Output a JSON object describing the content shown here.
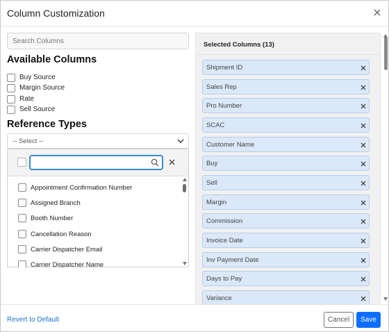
{
  "modal": {
    "title": "Column Customization",
    "close_icon": "close-icon"
  },
  "left": {
    "search_placeholder": "Search Columns",
    "available_heading": "Available Columns",
    "available_columns": [
      "Buy Source",
      "Margin Source",
      "Rate",
      "Sell Source"
    ],
    "reference_heading": "Reference Types",
    "reference_select": {
      "selected": "-- Select --",
      "search_value": "",
      "items": [
        "Appointment Confirmation Number",
        "Assigned Branch",
        "Booth Number",
        "Cancellation Reason",
        "Carrier Dispatcher Email",
        "Carrier Dispatcher Name"
      ]
    }
  },
  "right": {
    "title": "Selected Columns (13)",
    "selected_columns": [
      "Shipment ID",
      "Sales Rep",
      "Pro Number",
      "SCAC",
      "Customer Name",
      "Buy",
      "Sell",
      "Margin",
      "Commission",
      "Invoice Date",
      "Inv Payment Date",
      "Days to Pay",
      "Variance"
    ]
  },
  "footer": {
    "revert_label": "Revert to Default",
    "cancel_label": "Cancel",
    "save_label": "Save"
  },
  "colors": {
    "primary": "#0d6efd",
    "chip_bg": "#dbe8f8",
    "chip_border": "#b7cdea",
    "link": "#1a73c9",
    "focus_border": "#3b87d6"
  }
}
